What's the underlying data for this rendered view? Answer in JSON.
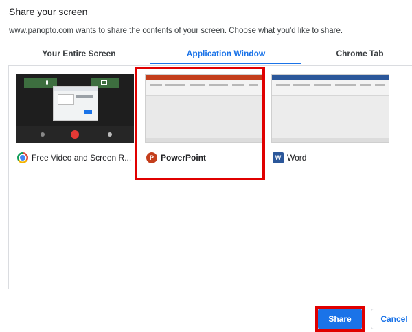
{
  "dialog": {
    "title": "Share your screen",
    "description": "www.panopto.com wants to share the contents of your screen. Choose what you'd like to share."
  },
  "tabs": [
    {
      "label": "Your Entire Screen",
      "selected": false
    },
    {
      "label": "Application Window",
      "selected": true
    },
    {
      "label": "Chrome Tab",
      "selected": false
    }
  ],
  "sources": [
    {
      "label": "Free Video and Screen R...",
      "icon": "chrome-icon",
      "selected": false
    },
    {
      "label": "PowerPoint",
      "icon": "powerpoint-icon",
      "selected": true
    },
    {
      "label": "Word",
      "icon": "word-icon",
      "selected": false
    }
  ],
  "icon_glyphs": {
    "powerpoint": "P",
    "word": "W"
  },
  "buttons": {
    "share": "Share",
    "cancel": "Cancel"
  },
  "colors": {
    "accent": "#1a73e8",
    "highlight": "#e00000",
    "powerpoint": "#c43e1c",
    "word": "#2b579a"
  }
}
